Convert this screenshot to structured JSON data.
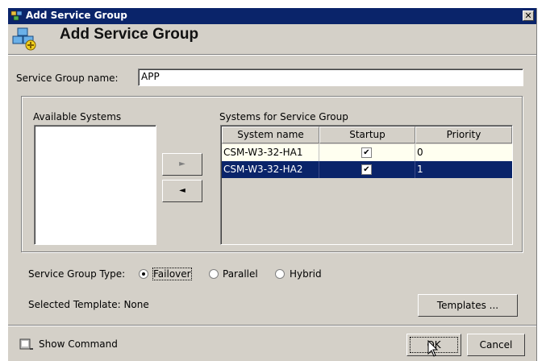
{
  "window": {
    "title": "Add Service Group",
    "header_title": "Add Service Group",
    "close_glyph": "✕"
  },
  "name_field": {
    "label": "Service Group name:",
    "value": "APP"
  },
  "available": {
    "label": "Available Systems",
    "items": []
  },
  "move_buttons": {
    "add_glyph": "►",
    "remove_glyph": "◄"
  },
  "systems_table": {
    "label": "Systems for Service Group",
    "columns": [
      "System name",
      "Startup",
      "Priority"
    ],
    "rows": [
      {
        "system_name": "CSM-W3-32-HA1",
        "startup": true,
        "priority": "0",
        "selected": false
      },
      {
        "system_name": "CSM-W3-32-HA2",
        "startup": true,
        "priority": "1",
        "selected": true
      }
    ]
  },
  "group_type": {
    "label": "Service Group Type:",
    "options": [
      {
        "label": "Failover",
        "selected": true
      },
      {
        "label": "Parallel",
        "selected": false
      },
      {
        "label": "Hybrid",
        "selected": false
      }
    ]
  },
  "template": {
    "label": "Selected Template: None",
    "button": "Templates ..."
  },
  "footer": {
    "show_command": "Show Command",
    "ok": "OK",
    "cancel": "Cancel"
  },
  "colors": {
    "titlebar": "#0a246a",
    "dialog_bg": "#d4d0c8",
    "selected_row": "#0a246a",
    "first_row": "#fffff0"
  }
}
